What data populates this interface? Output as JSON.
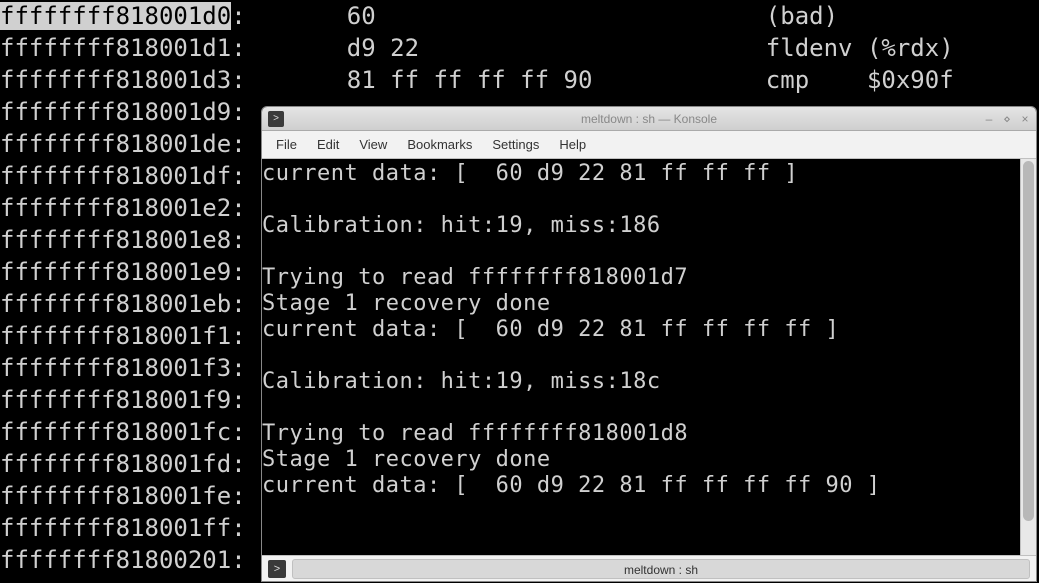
{
  "bg": {
    "rows": [
      {
        "addr": "ffffffff818001d0",
        "bytes": "60               ",
        "instr": "(bad)         ",
        "hl": true
      },
      {
        "addr": "ffffffff818001d1",
        "bytes": "d9 22            ",
        "instr": "fldenv (%rdx)"
      },
      {
        "addr": "ffffffff818001d3",
        "bytes": "81 ff ff ff ff 90",
        "instr": "cmp    $0x90f"
      },
      {
        "addr": "ffffffff818001d9",
        "bytes": "",
        "instr": ""
      },
      {
        "addr": "ffffffff818001de",
        "bytes": "",
        "instr": ""
      },
      {
        "addr": "ffffffff818001df",
        "bytes": "",
        "instr": ""
      },
      {
        "addr": "ffffffff818001e2",
        "bytes": "",
        "instr": ""
      },
      {
        "addr": "ffffffff818001e8",
        "bytes": "",
        "instr": ""
      },
      {
        "addr": "ffffffff818001e9",
        "bytes": "",
        "instr": ""
      },
      {
        "addr": "ffffffff818001eb",
        "bytes": "",
        "instr": ""
      },
      {
        "addr": "ffffffff818001f1",
        "bytes": "",
        "instr": ""
      },
      {
        "addr": "ffffffff818001f3",
        "bytes": "",
        "instr": ""
      },
      {
        "addr": "ffffffff818001f9",
        "bytes": "",
        "instr": ""
      },
      {
        "addr": "ffffffff818001fc",
        "bytes": "",
        "instr": ""
      },
      {
        "addr": "ffffffff818001fd",
        "bytes": "",
        "instr": ""
      },
      {
        "addr": "ffffffff818001fe",
        "bytes": "",
        "instr": ""
      },
      {
        "addr": "ffffffff818001ff",
        "bytes": "",
        "instr": ""
      },
      {
        "addr": "ffffffff81800201",
        "bytes": "",
        "instr": ""
      }
    ]
  },
  "window": {
    "title": "meltdown : sh — Konsole",
    "menus": [
      "File",
      "Edit",
      "View",
      "Bookmarks",
      "Settings",
      "Help"
    ],
    "status_tab": "meltdown : sh",
    "term_lines": [
      "current data: [  60 d9 22 81 ff ff ff ]",
      "",
      "Calibration: hit:19, miss:186",
      "",
      "Trying to read ffffffff818001d7",
      "Stage 1 recovery done",
      "current data: [  60 d9 22 81 ff ff ff ff ]",
      "",
      "Calibration: hit:19, miss:18c",
      "",
      "Trying to read ffffffff818001d8",
      "Stage 1 recovery done",
      "current data: [  60 d9 22 81 ff ff ff ff 90 ]"
    ]
  }
}
